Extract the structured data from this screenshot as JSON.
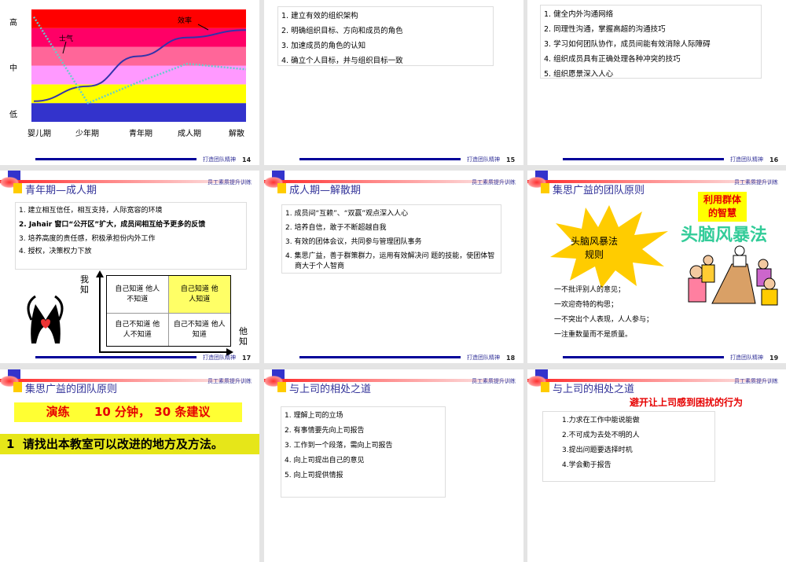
{
  "footer_text": "打造团队精神",
  "header_right": "员工素质提升训练",
  "slides": [
    {
      "number": "14",
      "chart_data": {
        "type": "line",
        "categories": [
          "婴儿期",
          "少年期",
          "青年期",
          "成人期",
          "解散"
        ],
        "y_ticks": [
          "高",
          "中",
          "低"
        ],
        "ylim": [
          0,
          6
        ],
        "bands": [
          "#3333cc",
          "#ffff00",
          "#ff99ff",
          "#ff6699",
          "#ff0066",
          "#ff0000"
        ],
        "series": [
          {
            "name": "效率",
            "color": "#3333aa",
            "style": "solid",
            "values": [
              1.1,
              1.9,
              3.5,
              4.5,
              4.9
            ]
          },
          {
            "name": "士气",
            "color": "#66cccc",
            "style": "dotted",
            "values": [
              5.6,
              1.0,
              2.1,
              3.1,
              2.8
            ]
          }
        ]
      }
    },
    {
      "number": "15",
      "items": [
        "1.  建立有效的组织架构",
        "2.  明确组织目标、方向和成员的角色",
        "3.  加速成员的角色的认知",
        "4.  确立个人目标，并与组织目标一致"
      ]
    },
    {
      "number": "16",
      "items": [
        "1.  健全内外沟通网络",
        "2.  同理性沟通，掌握高超的沟通技巧",
        "3.  学习如何团队协作，成员间能有效消除人际障碍",
        "4.  组织成员具有正确处理各种冲突的技巧",
        "5.  组织愿景深入人心"
      ]
    },
    {
      "number": "17",
      "title": "青年期—成人期",
      "items": [
        "1.  建立相互信任，相互支持，人际宽容的环境",
        "2. Jahair 窗口“公开区”扩大，成员间相互给予更多的反馈",
        "3.  培养高度的责任感，积极承担份内外工作",
        "4.  授权，决策权力下放"
      ],
      "axis_y": "我知",
      "axis_x": "他知",
      "matrix": [
        "自己知道 他人不知道",
        "自己知道 他人知道",
        "自己不知道 他人不知道",
        "自己不知道 他人知道"
      ]
    },
    {
      "number": "18",
      "title": "成人期—解散期",
      "items": [
        "1.  成员间“互赖”、“双赢”观点深入人心",
        "2.  培养自信，敢于不断超越自我",
        "3.  有效的团体会议，共同参与管理团队事务",
        "4.  集思广益，善于群策群力，运用有效解决问 题的技能，使团体智商大于个人智商"
      ]
    },
    {
      "number": "19",
      "title": "集思广益的团队原则",
      "burst": "头脑风暴法 规则",
      "yellow_label": "利用群体 的智慧",
      "green_title": "头脑风暴法",
      "rules": [
        "一不批评别人的意见；",
        "一欢迎奇特的构思；",
        "一不突出个人表现，人人参与；",
        "一注重数量而不是质量。"
      ]
    },
    {
      "title": "集思广益的团队原则",
      "drill": "演练      10 分钟， 30 条建议",
      "task": "1  请找出本教室可以改进的地方及方法。"
    },
    {
      "title": "与上司的相处之道",
      "items": [
        "1.  理解上司的立场",
        "2.  有事情要先向上司报告",
        "3.  工作到一个段落，需向上司报告",
        "4.  向上司提出自己的意见",
        "5.  向上司提供情报"
      ]
    },
    {
      "title": "与上司的相处之道",
      "subtitle": "避开让上司感到困扰的行为",
      "items": [
        "1.力求在工作中能说能做",
        "2.不可成为去处不明的人",
        "3.提出问题要选择时机",
        "4.学会勤于报告"
      ]
    }
  ]
}
